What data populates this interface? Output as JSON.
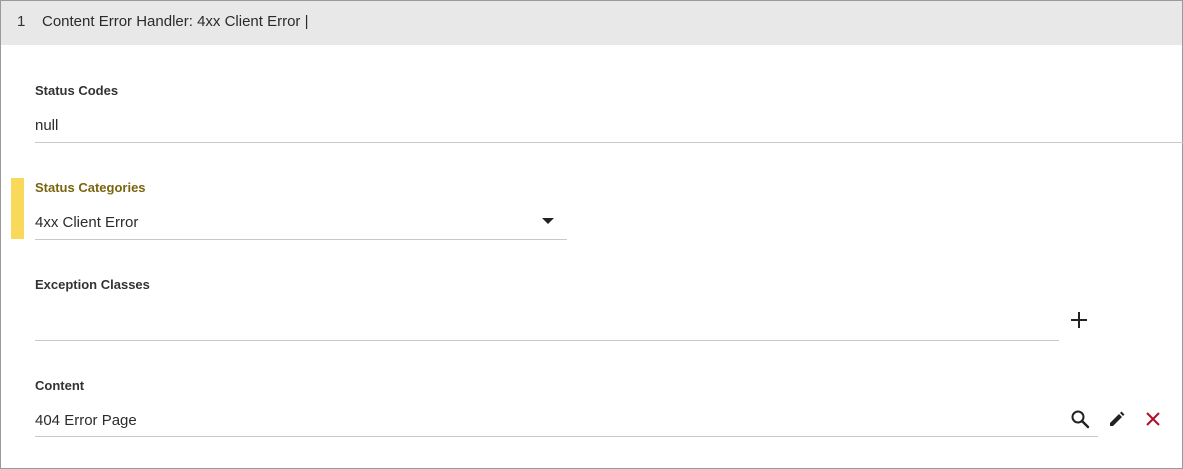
{
  "header": {
    "index": "1",
    "title": "Content Error Handler: 4xx Client Error |"
  },
  "fields": {
    "status_codes": {
      "label": "Status Codes",
      "value": "null"
    },
    "status_categories": {
      "label": "Status Categories",
      "value": "4xx Client Error"
    },
    "exception_classes": {
      "label": "Exception Classes",
      "value": ""
    },
    "content": {
      "label": "Content",
      "value": "404 Error Page"
    }
  },
  "icons": {
    "add": "plus-icon",
    "search": "search-icon",
    "edit": "pencil-icon",
    "remove": "close-icon",
    "dropdown": "caret-down-icon"
  },
  "colors": {
    "header_bg": "#e8e8e8",
    "focus_accent": "#f9d95a",
    "active_label": "#7a6410",
    "remove_icon": "#b0102a"
  }
}
